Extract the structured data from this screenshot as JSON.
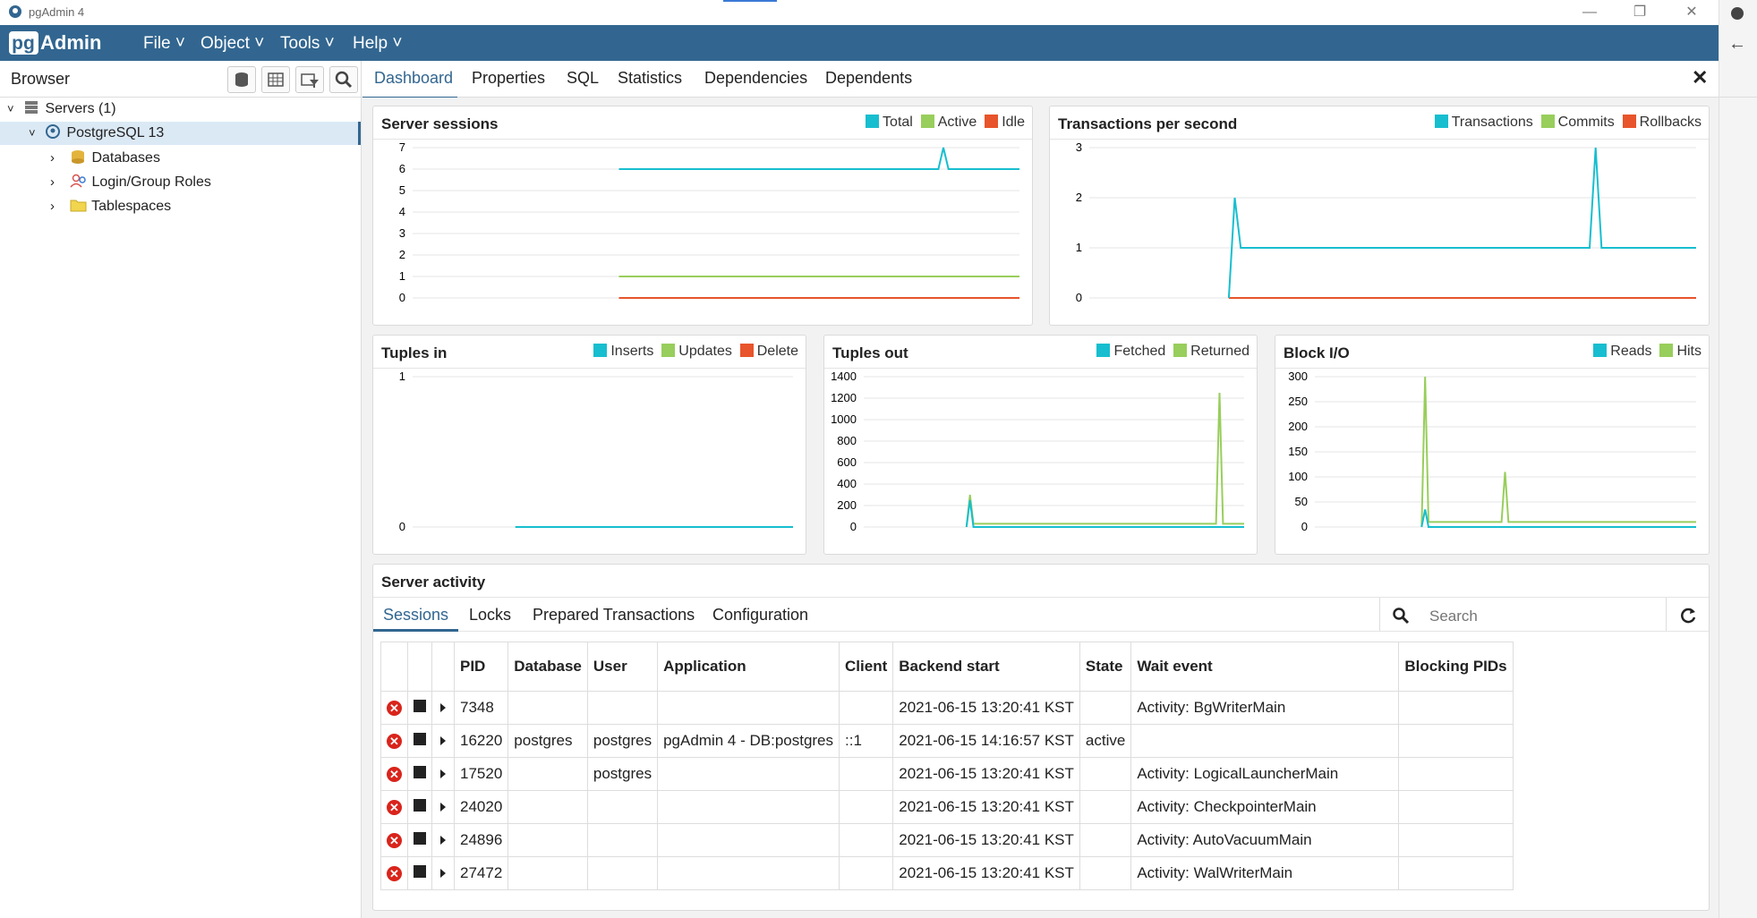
{
  "window": {
    "title": "pgAdmin 4"
  },
  "menu": {
    "items": [
      "File",
      "Object",
      "Tools",
      "Help"
    ],
    "logo_text": "pgAdmin"
  },
  "browser": {
    "title": "Browser",
    "tree": [
      {
        "label": "Servers (1)",
        "level": 0
      },
      {
        "label": "PostgreSQL 13",
        "level": 1
      },
      {
        "label": "Databases",
        "level": 2
      },
      {
        "label": "Login/Group Roles",
        "level": 2
      },
      {
        "label": "Tablespaces",
        "level": 2
      }
    ]
  },
  "tabs": [
    "Dashboard",
    "Properties",
    "SQL",
    "Statistics",
    "Dependencies",
    "Dependents"
  ],
  "active_tab": "Dashboard",
  "colors": {
    "blue": "#17becf",
    "green": "#98ce5c",
    "red": "#e8542b",
    "header": "#326690"
  },
  "chart_data": [
    {
      "title": "Server sessions",
      "type": "line",
      "legend": [
        "Total",
        "Active",
        "Idle"
      ],
      "yticks": [
        0,
        1,
        2,
        3,
        4,
        5,
        6,
        7
      ],
      "ylim": [
        0,
        7
      ],
      "series": [
        {
          "name": "Total",
          "values": [
            6,
            6,
            6,
            6,
            6,
            6,
            6,
            6,
            6,
            6,
            6,
            6,
            6,
            6,
            6,
            6,
            6,
            6,
            6,
            6,
            6,
            6,
            6,
            6,
            6,
            6,
            6,
            6,
            6,
            6,
            6,
            6,
            6,
            6,
            6,
            6,
            6,
            6,
            6,
            6,
            6,
            6,
            6,
            6,
            6,
            6,
            6,
            7,
            6,
            6,
            6,
            6,
            6,
            6,
            6,
            6,
            6,
            6,
            6,
            6,
            6,
            6,
            6,
            6,
            6,
            6,
            6,
            6,
            6,
            6,
            6,
            6,
            6,
            6,
            6
          ]
        },
        {
          "name": "Active",
          "values": "const:1"
        },
        {
          "name": "Idle",
          "values": "const:0"
        }
      ]
    },
    {
      "title": "Transactions per second",
      "type": "line",
      "legend": [
        "Transactions",
        "Commits",
        "Rollbacks"
      ],
      "yticks": [
        0,
        1,
        2,
        3
      ],
      "ylim": [
        0,
        3
      ]
    },
    {
      "title": "Tuples in",
      "type": "line",
      "legend": [
        "Inserts",
        "Updates",
        "Delete"
      ],
      "yticks": [
        0,
        1
      ],
      "ylim": [
        0,
        1
      ]
    },
    {
      "title": "Tuples out",
      "type": "line",
      "legend": [
        "Fetched",
        "Returned"
      ],
      "yticks": [
        0,
        200,
        400,
        600,
        800,
        1000,
        1200,
        1400
      ],
      "ylim": [
        0,
        1400
      ]
    },
    {
      "title": "Block I/O",
      "type": "line",
      "legend": [
        "Reads",
        "Hits"
      ],
      "yticks": [
        0,
        50,
        100,
        150,
        200,
        250,
        300
      ],
      "ylim": [
        0,
        300
      ]
    }
  ],
  "activity": {
    "title": "Server activity",
    "subtabs": [
      "Sessions",
      "Locks",
      "Prepared Transactions",
      "Configuration"
    ],
    "search_placeholder": "Search",
    "columns": [
      "PID",
      "Database",
      "User",
      "Application",
      "Client",
      "Backend start",
      "State",
      "Wait event",
      "Blocking PIDs"
    ],
    "rows": [
      [
        "7348",
        "",
        "",
        "",
        "",
        "2021-06-15 13:20:41 KST",
        "",
        "Activity: BgWriterMain",
        ""
      ],
      [
        "16220",
        "postgres",
        "postgres",
        "pgAdmin 4 - DB:postgres",
        "::1",
        "2021-06-15 14:16:57 KST",
        "active",
        "",
        ""
      ],
      [
        "17520",
        "",
        "postgres",
        "",
        "",
        "2021-06-15 13:20:41 KST",
        "",
        "Activity: LogicalLauncherMain",
        ""
      ],
      [
        "24020",
        "",
        "",
        "",
        "",
        "2021-06-15 13:20:41 KST",
        "",
        "Activity: CheckpointerMain",
        ""
      ],
      [
        "24896",
        "",
        "",
        "",
        "",
        "2021-06-15 13:20:41 KST",
        "",
        "Activity: AutoVacuumMain",
        ""
      ],
      [
        "27472",
        "",
        "",
        "",
        "",
        "2021-06-15 13:20:41 KST",
        "",
        "Activity: WalWriterMain",
        ""
      ]
    ]
  }
}
